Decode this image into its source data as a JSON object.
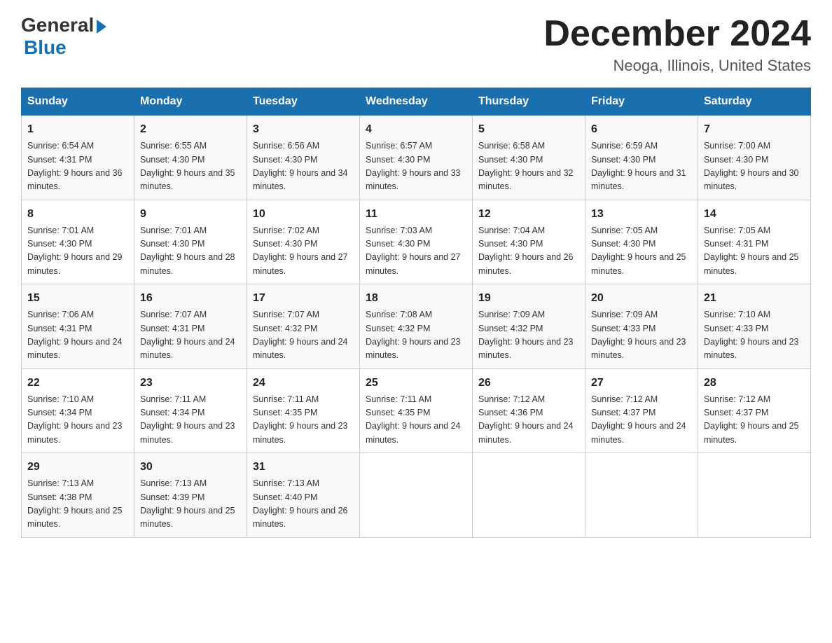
{
  "header": {
    "logo_general": "General",
    "logo_blue": "Blue",
    "month_title": "December 2024",
    "location": "Neoga, Illinois, United States"
  },
  "days_of_week": [
    "Sunday",
    "Monday",
    "Tuesday",
    "Wednesday",
    "Thursday",
    "Friday",
    "Saturday"
  ],
  "weeks": [
    [
      {
        "num": "1",
        "sunrise": "6:54 AM",
        "sunset": "4:31 PM",
        "daylight": "9 hours and 36 minutes."
      },
      {
        "num": "2",
        "sunrise": "6:55 AM",
        "sunset": "4:30 PM",
        "daylight": "9 hours and 35 minutes."
      },
      {
        "num": "3",
        "sunrise": "6:56 AM",
        "sunset": "4:30 PM",
        "daylight": "9 hours and 34 minutes."
      },
      {
        "num": "4",
        "sunrise": "6:57 AM",
        "sunset": "4:30 PM",
        "daylight": "9 hours and 33 minutes."
      },
      {
        "num": "5",
        "sunrise": "6:58 AM",
        "sunset": "4:30 PM",
        "daylight": "9 hours and 32 minutes."
      },
      {
        "num": "6",
        "sunrise": "6:59 AM",
        "sunset": "4:30 PM",
        "daylight": "9 hours and 31 minutes."
      },
      {
        "num": "7",
        "sunrise": "7:00 AM",
        "sunset": "4:30 PM",
        "daylight": "9 hours and 30 minutes."
      }
    ],
    [
      {
        "num": "8",
        "sunrise": "7:01 AM",
        "sunset": "4:30 PM",
        "daylight": "9 hours and 29 minutes."
      },
      {
        "num": "9",
        "sunrise": "7:01 AM",
        "sunset": "4:30 PM",
        "daylight": "9 hours and 28 minutes."
      },
      {
        "num": "10",
        "sunrise": "7:02 AM",
        "sunset": "4:30 PM",
        "daylight": "9 hours and 27 minutes."
      },
      {
        "num": "11",
        "sunrise": "7:03 AM",
        "sunset": "4:30 PM",
        "daylight": "9 hours and 27 minutes."
      },
      {
        "num": "12",
        "sunrise": "7:04 AM",
        "sunset": "4:30 PM",
        "daylight": "9 hours and 26 minutes."
      },
      {
        "num": "13",
        "sunrise": "7:05 AM",
        "sunset": "4:30 PM",
        "daylight": "9 hours and 25 minutes."
      },
      {
        "num": "14",
        "sunrise": "7:05 AM",
        "sunset": "4:31 PM",
        "daylight": "9 hours and 25 minutes."
      }
    ],
    [
      {
        "num": "15",
        "sunrise": "7:06 AM",
        "sunset": "4:31 PM",
        "daylight": "9 hours and 24 minutes."
      },
      {
        "num": "16",
        "sunrise": "7:07 AM",
        "sunset": "4:31 PM",
        "daylight": "9 hours and 24 minutes."
      },
      {
        "num": "17",
        "sunrise": "7:07 AM",
        "sunset": "4:32 PM",
        "daylight": "9 hours and 24 minutes."
      },
      {
        "num": "18",
        "sunrise": "7:08 AM",
        "sunset": "4:32 PM",
        "daylight": "9 hours and 23 minutes."
      },
      {
        "num": "19",
        "sunrise": "7:09 AM",
        "sunset": "4:32 PM",
        "daylight": "9 hours and 23 minutes."
      },
      {
        "num": "20",
        "sunrise": "7:09 AM",
        "sunset": "4:33 PM",
        "daylight": "9 hours and 23 minutes."
      },
      {
        "num": "21",
        "sunrise": "7:10 AM",
        "sunset": "4:33 PM",
        "daylight": "9 hours and 23 minutes."
      }
    ],
    [
      {
        "num": "22",
        "sunrise": "7:10 AM",
        "sunset": "4:34 PM",
        "daylight": "9 hours and 23 minutes."
      },
      {
        "num": "23",
        "sunrise": "7:11 AM",
        "sunset": "4:34 PM",
        "daylight": "9 hours and 23 minutes."
      },
      {
        "num": "24",
        "sunrise": "7:11 AM",
        "sunset": "4:35 PM",
        "daylight": "9 hours and 23 minutes."
      },
      {
        "num": "25",
        "sunrise": "7:11 AM",
        "sunset": "4:35 PM",
        "daylight": "9 hours and 24 minutes."
      },
      {
        "num": "26",
        "sunrise": "7:12 AM",
        "sunset": "4:36 PM",
        "daylight": "9 hours and 24 minutes."
      },
      {
        "num": "27",
        "sunrise": "7:12 AM",
        "sunset": "4:37 PM",
        "daylight": "9 hours and 24 minutes."
      },
      {
        "num": "28",
        "sunrise": "7:12 AM",
        "sunset": "4:37 PM",
        "daylight": "9 hours and 25 minutes."
      }
    ],
    [
      {
        "num": "29",
        "sunrise": "7:13 AM",
        "sunset": "4:38 PM",
        "daylight": "9 hours and 25 minutes."
      },
      {
        "num": "30",
        "sunrise": "7:13 AM",
        "sunset": "4:39 PM",
        "daylight": "9 hours and 25 minutes."
      },
      {
        "num": "31",
        "sunrise": "7:13 AM",
        "sunset": "4:40 PM",
        "daylight": "9 hours and 26 minutes."
      },
      null,
      null,
      null,
      null
    ]
  ],
  "labels": {
    "sunrise_prefix": "Sunrise: ",
    "sunset_prefix": "Sunset: ",
    "daylight_prefix": "Daylight: "
  }
}
